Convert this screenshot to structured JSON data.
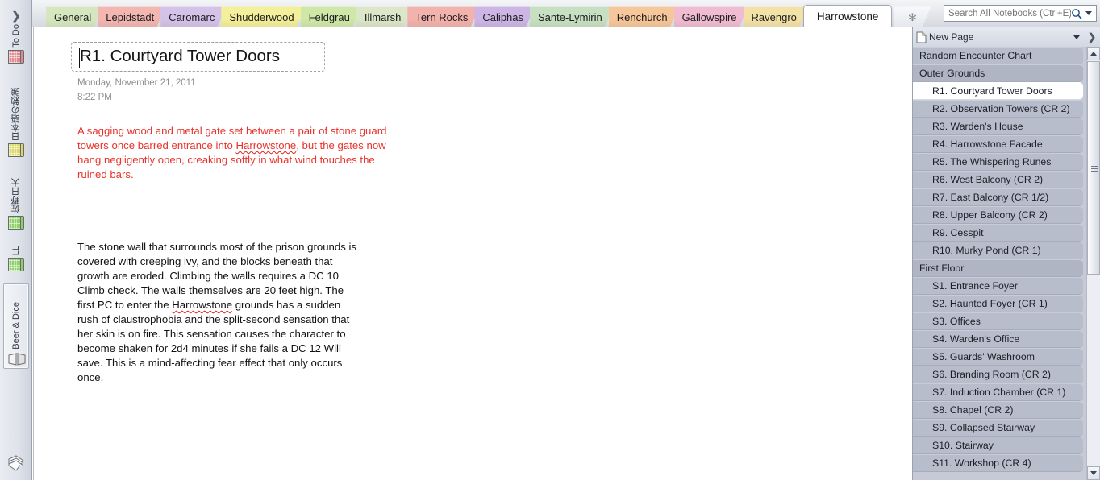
{
  "nav_rail": {
    "expand_glyph": "❯",
    "notebooks": [
      {
        "label": "To Do",
        "icon": "notebook-icon",
        "color": "#e08a90",
        "selected": false
      },
      {
        "label": "日本語の勉強",
        "icon": "notebook-icon",
        "color": "#dbd966",
        "selected": false
      },
      {
        "label": "佐野日大",
        "icon": "notebook-icon",
        "color": "#8ed06a",
        "selected": false
      },
      {
        "label": "LL",
        "icon": "notebook-icon",
        "color": "#8ed06a",
        "selected": false
      },
      {
        "label": "Beer & Dice",
        "icon": "open-notebook-icon",
        "color": "#e9e9e9",
        "selected": true
      }
    ],
    "unfiled_icon": "unfiled-notes-icon"
  },
  "tabbar": {
    "sections": [
      {
        "label": "General",
        "color": "#d6e7c0",
        "active": false
      },
      {
        "label": "Lepidstadt",
        "color": "#f3b7b2",
        "active": false
      },
      {
        "label": "Caromarc",
        "color": "#d5c2e8",
        "active": false
      },
      {
        "label": "Shudderwood",
        "color": "#f4ef9a",
        "active": false
      },
      {
        "label": "Feldgrau",
        "color": "#cfe8a8",
        "active": false
      },
      {
        "label": "Illmarsh",
        "color": "#dce6c9",
        "active": false
      },
      {
        "label": "Tern Rocks",
        "color": "#f3b3ad",
        "active": false
      },
      {
        "label": "Caliphas",
        "color": "#cdb6e6",
        "active": false
      },
      {
        "label": "Sante-Lymirin",
        "color": "#c8e0c2",
        "active": false
      },
      {
        "label": "Renchurch",
        "color": "#f6c79a",
        "active": false
      },
      {
        "label": "Gallowspire",
        "color": "#f0bcd2",
        "active": false
      },
      {
        "label": "Ravengro",
        "color": "#f3e2a8",
        "active": false
      },
      {
        "label": "Harrowstone",
        "color": "#ffffff",
        "active": true
      }
    ],
    "new_section": {
      "name": "new-section-button",
      "glyph": "✻"
    }
  },
  "search": {
    "placeholder": "Search All Notebooks (Ctrl+E)",
    "value": "",
    "icon": "search-icon",
    "caret": "chevron-down-icon"
  },
  "page": {
    "title": "R1. Courtyard Tower Doors",
    "date": "Monday, November  21, 2011",
    "time": "8:22 PM",
    "paragraph_red_parts": [
      {
        "text": "A sagging wood and metal gate set between a pair of stone guard towers once barred entrance into ",
        "misspelled": false
      },
      {
        "text": "Harrowstone",
        "misspelled": true
      },
      {
        "text": ", but the gates now hang negligently open, creaking softly in what wind touches the ruined bars.",
        "misspelled": false
      }
    ],
    "paragraph_body_parts": [
      {
        "text": "The stone wall that surrounds most of the prison grounds is covered with creeping ivy, and the blocks beneath that growth are eroded. Climbing the walls requires a DC 10 Climb check. The walls themselves are 20 feet high. The first PC to enter the ",
        "misspelled": false
      },
      {
        "text": "Harrowstone",
        "misspelled": true
      },
      {
        "text": " grounds has a sudden rush of claustrophobia and the split-second sensation that her skin is on fire. This sensation causes the character to become shaken for 2d4 minutes if she fails a DC 12 Will save. This is a mind-affecting fear effect that only occurs once.",
        "misspelled": false
      }
    ],
    "red_color": "#e8342c"
  },
  "page_pane": {
    "new_page_label": "New Page",
    "new_page_icon": "new-page-icon",
    "new_page_caret": "chevron-down-icon",
    "expand_glyph": "❯",
    "pages": [
      {
        "label": "Random Encounter Chart",
        "level": 1,
        "selected": false,
        "is_section_head": false
      },
      {
        "label": "Outer Grounds",
        "level": 1,
        "selected": false,
        "is_section_head": true
      },
      {
        "label": "R1. Courtyard Tower Doors",
        "level": 2,
        "selected": true,
        "is_section_head": false
      },
      {
        "label": "R2. Observation Towers (CR 2)",
        "level": 2,
        "selected": false,
        "is_section_head": false
      },
      {
        "label": "R3. Warden's House",
        "level": 2,
        "selected": false,
        "is_section_head": false
      },
      {
        "label": "R4. Harrowstone Facade",
        "level": 2,
        "selected": false,
        "is_section_head": false
      },
      {
        "label": "R5. The Whispering Runes",
        "level": 2,
        "selected": false,
        "is_section_head": false
      },
      {
        "label": "R6. West Balcony (CR 2)",
        "level": 2,
        "selected": false,
        "is_section_head": false
      },
      {
        "label": "R7. East Balcony (CR 1/2)",
        "level": 2,
        "selected": false,
        "is_section_head": false
      },
      {
        "label": "R8. Upper Balcony (CR 2)",
        "level": 2,
        "selected": false,
        "is_section_head": false
      },
      {
        "label": "R9. Cesspit",
        "level": 2,
        "selected": false,
        "is_section_head": false
      },
      {
        "label": "R10. Murky Pond (CR 1)",
        "level": 2,
        "selected": false,
        "is_section_head": false
      },
      {
        "label": "First Floor",
        "level": 1,
        "selected": false,
        "is_section_head": true
      },
      {
        "label": "S1. Entrance Foyer",
        "level": 2,
        "selected": false,
        "is_section_head": false
      },
      {
        "label": "S2. Haunted Foyer (CR 1)",
        "level": 2,
        "selected": false,
        "is_section_head": false
      },
      {
        "label": "S3. Offices",
        "level": 2,
        "selected": false,
        "is_section_head": false
      },
      {
        "label": "S4. Warden's Office",
        "level": 2,
        "selected": false,
        "is_section_head": false
      },
      {
        "label": "S5. Guards' Washroom",
        "level": 2,
        "selected": false,
        "is_section_head": false
      },
      {
        "label": "S6. Branding Room (CR 2)",
        "level": 2,
        "selected": false,
        "is_section_head": false
      },
      {
        "label": "S7. Induction Chamber (CR 1)",
        "level": 2,
        "selected": false,
        "is_section_head": false
      },
      {
        "label": "S8. Chapel (CR 2)",
        "level": 2,
        "selected": false,
        "is_section_head": false
      },
      {
        "label": "S9. Collapsed Stairway",
        "level": 2,
        "selected": false,
        "is_section_head": false
      },
      {
        "label": "S10. Stairway",
        "level": 2,
        "selected": false,
        "is_section_head": false
      },
      {
        "label": "S11. Workshop (CR 4)",
        "level": 2,
        "selected": false,
        "is_section_head": false
      }
    ],
    "scrollbar": {
      "up_icon": "scroll-up-icon",
      "down_icon": "scroll-down-icon",
      "thumb": "scrollbar-thumb"
    }
  }
}
